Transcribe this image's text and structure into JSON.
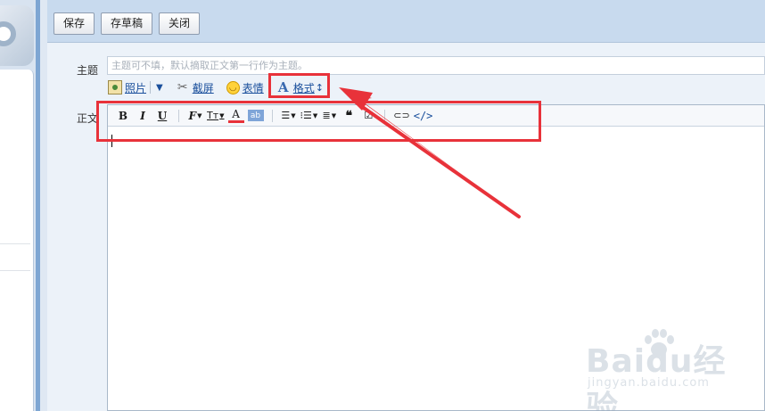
{
  "toolbar": {
    "save_label": "保存",
    "draft_label": "存草稿",
    "close_label": "关闭"
  },
  "subject": {
    "label": "主题",
    "placeholder": "主题可不填，默认摘取正文第一行作为主题。"
  },
  "attachments": {
    "photo_label": "照片",
    "screenshot_label": "截屏",
    "emoji_label": "表情",
    "format_label": "格式"
  },
  "body": {
    "label": "正文",
    "value": ""
  },
  "editor_toolbar": {
    "bold": "B",
    "italic": "I",
    "underline": "U",
    "font_style": "F",
    "font_size": "Tт",
    "font_color": "A",
    "bg_color": "ab",
    "source": "</>"
  },
  "icons": [
    "photo-icon",
    "scissors-icon",
    "smile-icon",
    "format-icon",
    "font-style-icon",
    "font-size-icon",
    "font-color-icon",
    "bg-color-icon",
    "align-icon",
    "bullet-list-icon",
    "numbered-list-icon",
    "quote-icon",
    "checkbox-icon",
    "link-icon",
    "source-code-icon"
  ],
  "colors": {
    "accent": "#1a4f9c",
    "annotation_red": "#e8323a",
    "toolbar_bg": "#c8daee"
  },
  "watermark": {
    "brand": "Baidu经验",
    "url": "jingyan.baidu.com"
  }
}
